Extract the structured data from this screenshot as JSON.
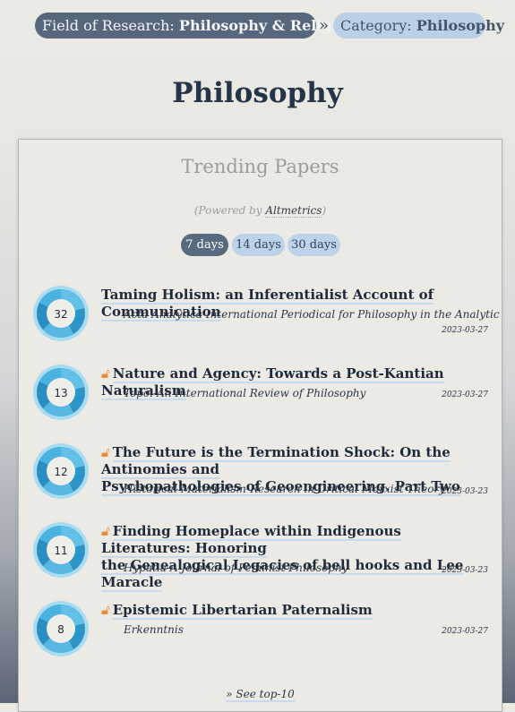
{
  "breadcrumb": {
    "field_prefix": "Field of Research: ",
    "field_name": "Philosophy & Religion",
    "separator": "»",
    "category_prefix": "Category: ",
    "category_name": "Philosophy"
  },
  "page_title": "Philosophy",
  "panel": {
    "title": "Trending Papers",
    "powered_prefix": "(Powered by ",
    "powered_link": "Altmetrics",
    "powered_suffix": ")",
    "tabs": [
      {
        "label": "7 days",
        "active": true
      },
      {
        "label": "14 days",
        "active": false
      },
      {
        "label": "30 days",
        "active": false
      }
    ],
    "see_more": "» See top-10"
  },
  "papers": [
    {
      "score": "32",
      "open_access": false,
      "title": "Taming Holism: an Inferentialist Account of Communication",
      "journal": "Acta Analytica-International Periodical for Philosophy in the Analytic",
      "date": "2023-03-27"
    },
    {
      "score": "13",
      "open_access": true,
      "title": "Nature and Agency: Towards a Post-Kantian Naturalism",
      "journal": "Topoi-An International Review of Philosophy",
      "date": "2023-03-27"
    },
    {
      "score": "12",
      "open_access": true,
      "title_line1": "The Future is the Termination Shock: On the Antinomies and",
      "title_line2": "Psychopathologies of Geoengineering. Part Two",
      "journal": "Historical Materialism-Research in Critical Marxist Theory",
      "date": "2023-03-23"
    },
    {
      "score": "11",
      "open_access": true,
      "title_line1": "Finding Homeplace within Indigenous Literatures: Honoring",
      "title_line2": "the Genealogical Legacies of bell hooks and Lee Maracle",
      "journal": "Hypatia-A Journal of Feminist Philosophy",
      "date": "2023-03-23"
    },
    {
      "score": "8",
      "open_access": true,
      "title": "Epistemic Libertarian Paternalism",
      "journal": "Erkenntnis",
      "date": "2023-03-27"
    }
  ],
  "icons": {
    "open_access": "open-access-lock-icon",
    "score_badge": "altmetric-donut-icon"
  },
  "colors": {
    "breadcrumb_field_bg": "#56667c",
    "breadcrumb_category_bg": "#b9d0e6",
    "tab_active_bg": "#586a80",
    "tab_inactive_bg": "#bcd3ea",
    "open_access": "#e88d36",
    "donut": "#3aa8d8"
  }
}
